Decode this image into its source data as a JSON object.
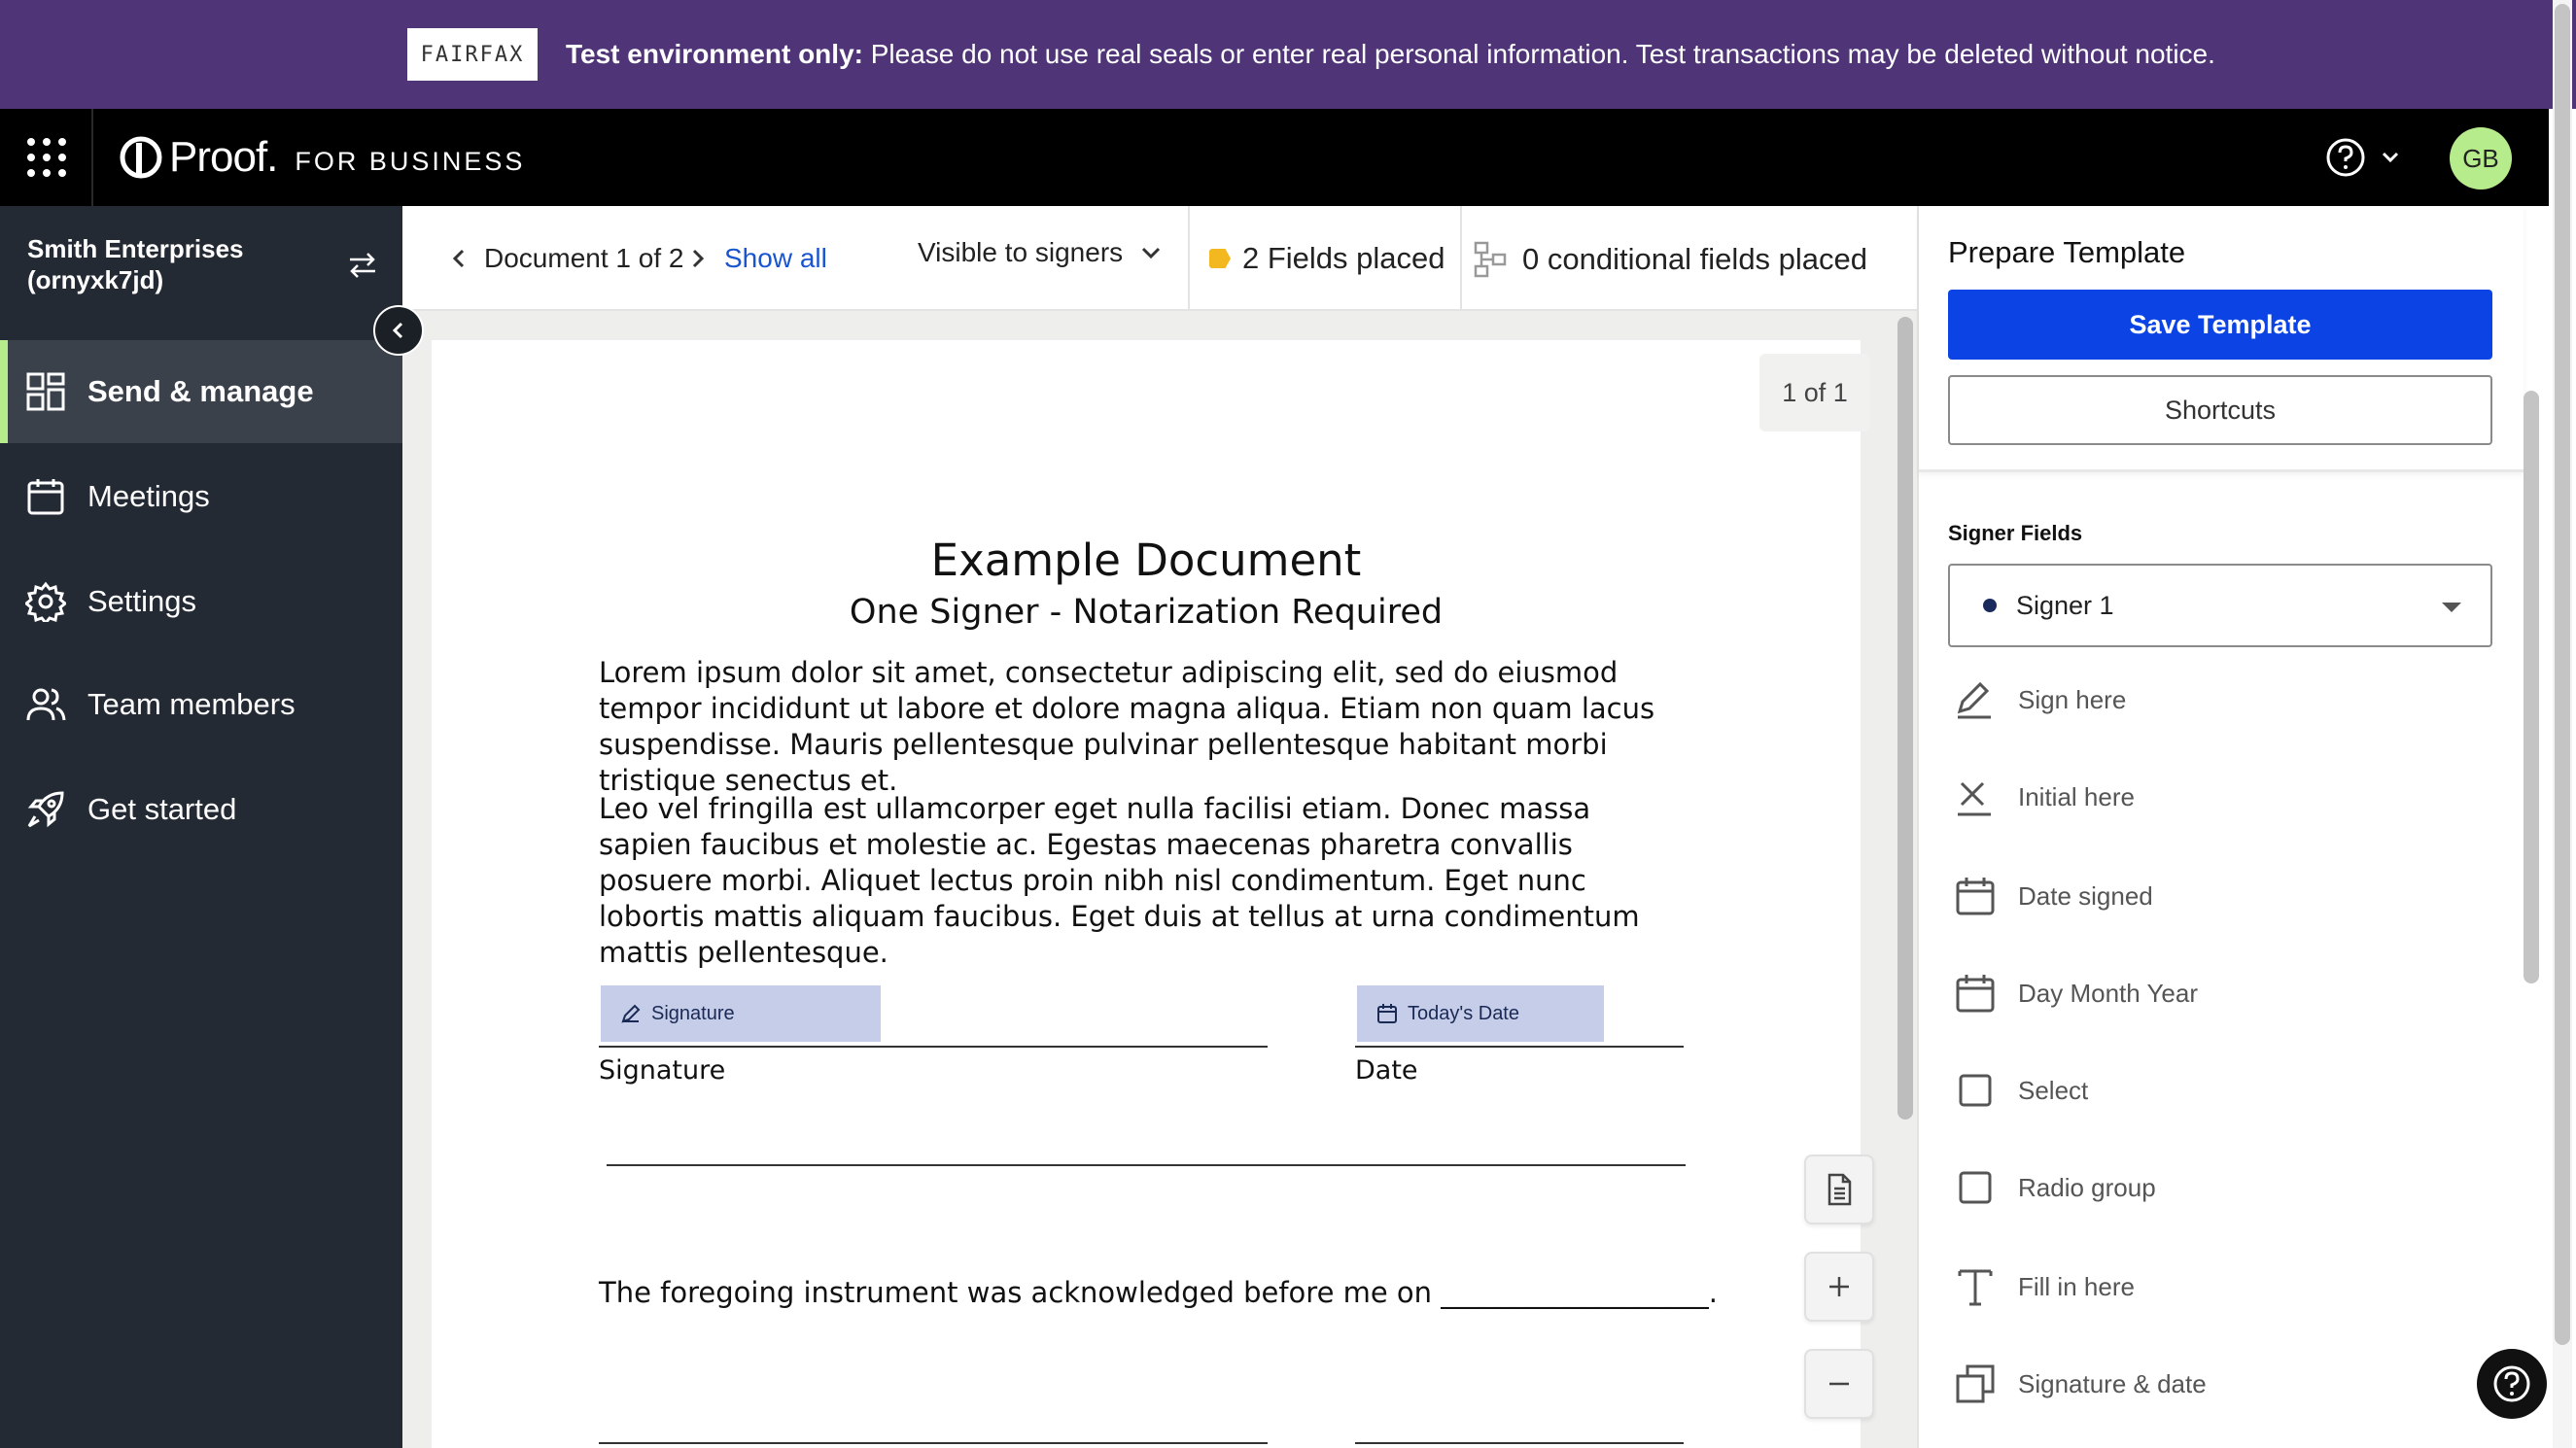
{
  "banner": {
    "logo_text": "FAIRFAX",
    "bold_text": "Test environment only:",
    "message": " Please do not use real seals or enter real personal information. Test transactions may be deleted without notice."
  },
  "topbar": {
    "brand_name": "Proof.",
    "brand_suffix": "FOR BUSINESS",
    "avatar_initials": "GB"
  },
  "sidebar": {
    "org_name": "Smith Enterprises",
    "org_id": "(ornyxk7jd)",
    "items": [
      {
        "label": "Send & manage",
        "icon": "grid-icon",
        "active": true
      },
      {
        "label": "Meetings",
        "icon": "calendar-icon",
        "active": false
      },
      {
        "label": "Settings",
        "icon": "gear-icon",
        "active": false
      },
      {
        "label": "Team members",
        "icon": "users-icon",
        "active": false
      },
      {
        "label": "Get started",
        "icon": "rocket-icon",
        "active": false
      }
    ]
  },
  "toolbar": {
    "doc_count": "Document 1 of 2",
    "show_all": "Show all",
    "visibility": "Visible to signers",
    "fields_placed": "2 Fields placed",
    "conditional_placed": "0 conditional fields placed"
  },
  "document": {
    "page_indicator": "1 of 1",
    "title": "Example Document",
    "subtitle": "One Signer - Notarization Required",
    "paragraph1": "Lorem ipsum dolor sit amet, consectetur adipiscing elit, sed do eiusmod tempor incididunt ut labore et dolore magna aliqua. Etiam non quam lacus suspendisse. Mauris pellentesque pulvinar pellentesque habitant morbi tristique senectus et.",
    "paragraph2": "Leo vel fringilla est ullamcorper eget nulla facilisi etiam. Donec massa sapien faucibus et molestie ac. Egestas maecenas pharetra convallis posuere morbi. Aliquet lectus proin nibh nisl condimentum. Eget nunc lobortis mattis aliquam faucibus. Eget duis at tellus at urna condimentum mattis pellentesque.",
    "signature_chip": "Signature",
    "date_chip": "Today's Date",
    "signature_label": "Signature",
    "date_label": "Date",
    "acknowledgement": "The foregoing instrument was acknowledged before me on ___________________."
  },
  "panel": {
    "title": "Prepare Template",
    "save_label": "Save Template",
    "shortcuts_label": "Shortcuts",
    "signer_fields_label": "Signer Fields",
    "selected_signer": "Signer 1",
    "tools": [
      {
        "label": "Sign here",
        "icon": "pen-icon"
      },
      {
        "label": "Initial here",
        "icon": "x-mark-icon"
      },
      {
        "label": "Date signed",
        "icon": "calendar-icon"
      },
      {
        "label": "Day Month Year",
        "icon": "calendar-icon"
      },
      {
        "label": "Select",
        "icon": "checkbox-icon"
      },
      {
        "label": "Radio group",
        "icon": "checkbox-icon"
      },
      {
        "label": "Fill in here",
        "icon": "text-icon"
      },
      {
        "label": "Signature & date",
        "icon": "copy-icon"
      }
    ]
  },
  "colors": {
    "banner_bg": "#4f3477",
    "primary": "#0c43e5",
    "accent_green": "#b7ec8c",
    "sidebar_bg": "#232a34",
    "field_chip": "#c5cde8"
  }
}
